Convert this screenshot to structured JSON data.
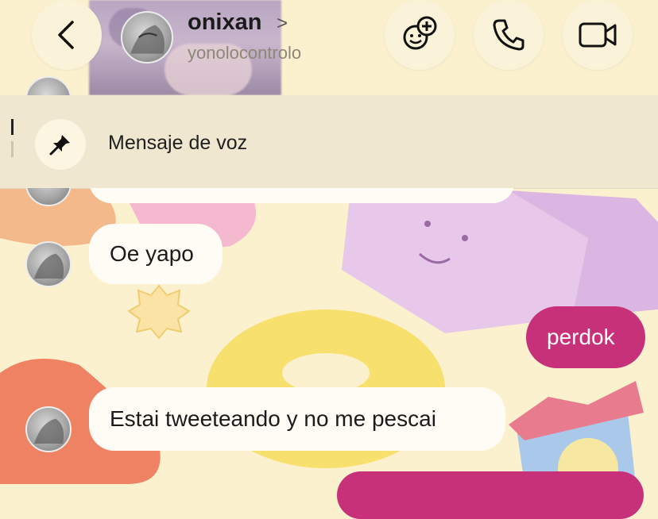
{
  "header": {
    "username": "onixan",
    "chevron": ">",
    "handle": "yonolocontrolo",
    "back_icon": "back-chevron-icon",
    "actions": [
      "add-emoji-icon",
      "phone-icon",
      "video-camera-icon"
    ]
  },
  "pinned": {
    "label": "Mensaje de voz",
    "icon": "pin-icon"
  },
  "messages": [
    {
      "text": "Oe yapo",
      "sender": "them"
    },
    {
      "text": "perdok",
      "sender": "me"
    },
    {
      "text": "Estai tweeteando y no me pescai",
      "sender": "them"
    }
  ],
  "colors": {
    "background": "#fbf1cf",
    "sent_bubble": "#c7317a",
    "received_bubble": "#fefcf5",
    "pin_bar": "#efe7d0"
  }
}
